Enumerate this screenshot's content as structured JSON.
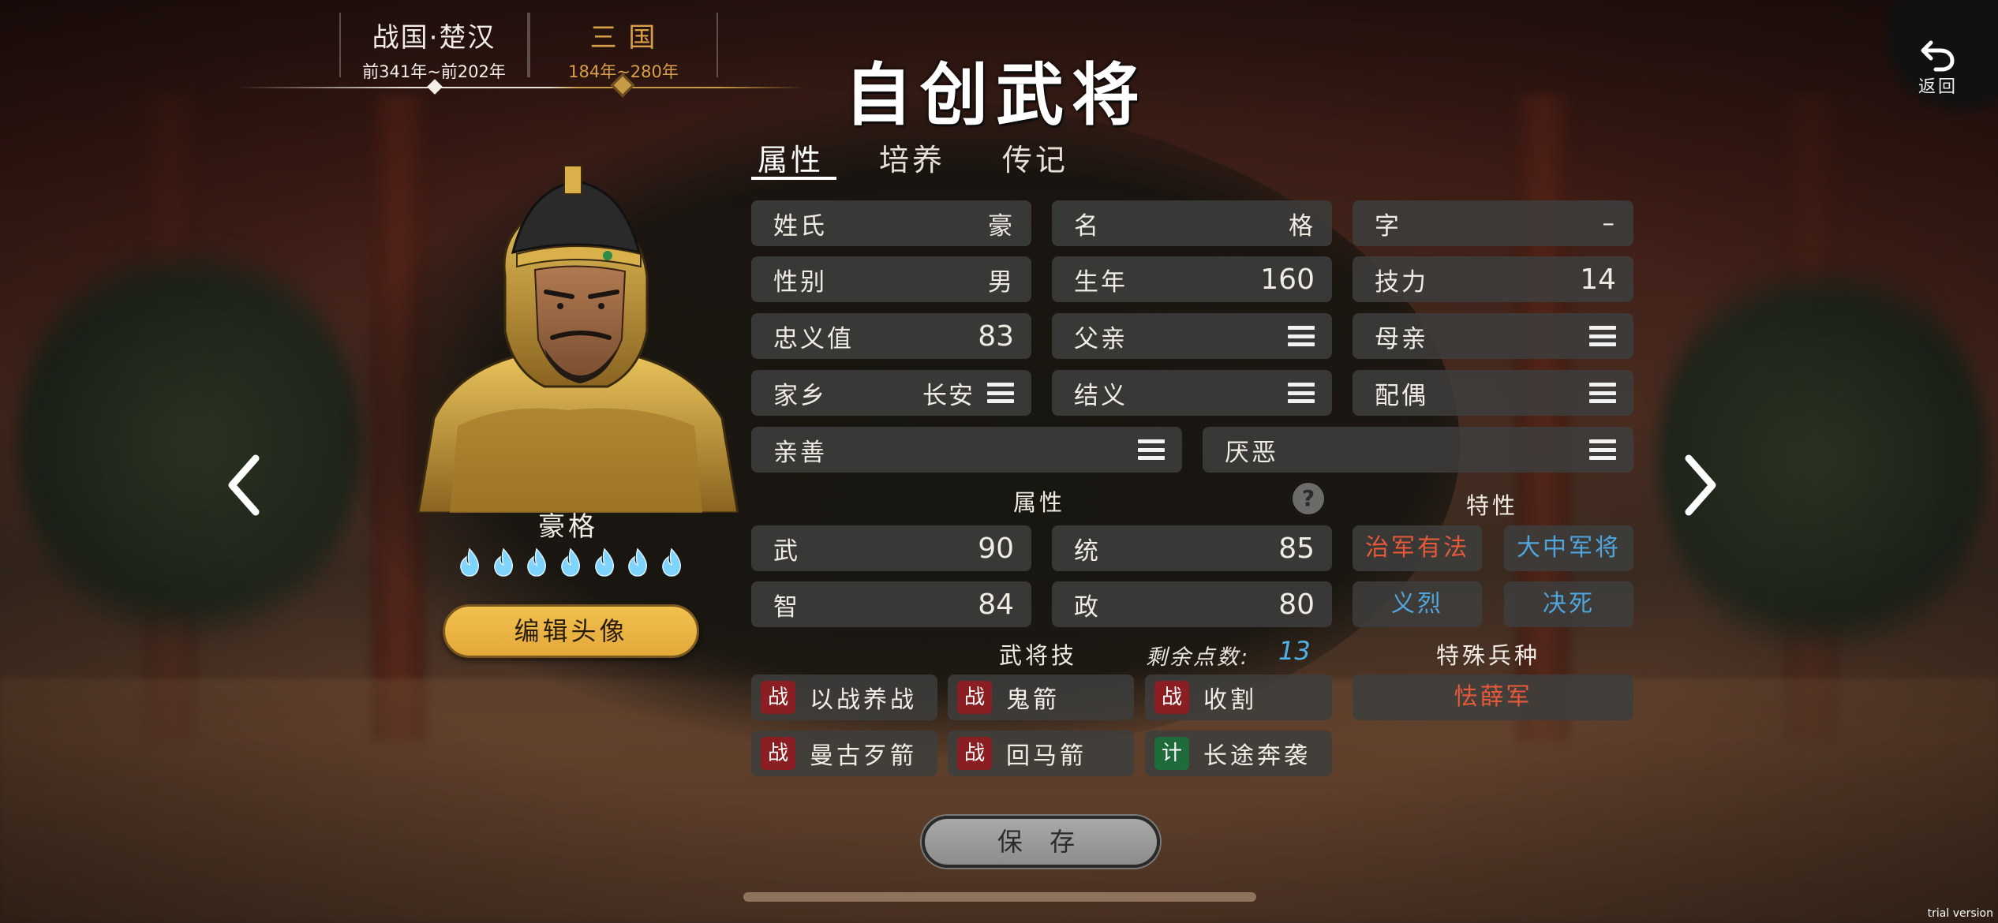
{
  "colors": {
    "accent_gold": "#c79a45",
    "trait_red": "#e8593a",
    "trait_blue": "#4fa6dd",
    "skill_battle": "#8b1e22",
    "skill_strategy": "#1f6b3c",
    "remaining_points": "#4fb1e8"
  },
  "eras": [
    {
      "name": "战国·楚汉",
      "range": "前341年~前202年",
      "active": false
    },
    {
      "name": "三 国",
      "range": "184年~280年",
      "active": true
    }
  ],
  "title": "自创武将",
  "back": {
    "label": "返回",
    "icon": "undo-arrow-icon"
  },
  "tabs": [
    {
      "label": "属性",
      "active": true
    },
    {
      "label": "培养",
      "active": false
    },
    {
      "label": "传记",
      "active": false
    }
  ],
  "hero": {
    "name": "豪格",
    "stars": 7,
    "star_icon": "blue-flame-icon",
    "edit_avatar_label": "编辑头像",
    "portrait_icon": "general-portrait-icon"
  },
  "info": {
    "surname": {
      "label": "姓氏",
      "value": "豪"
    },
    "given_name": {
      "label": "名",
      "value": "格"
    },
    "courtesy": {
      "label": "字",
      "value": "–"
    },
    "gender": {
      "label": "性别",
      "value": "男"
    },
    "birth_year": {
      "label": "生年",
      "value": "160"
    },
    "skill_points": {
      "label": "技力",
      "value": "14"
    },
    "loyalty": {
      "label": "忠义值",
      "value": "83"
    },
    "father": {
      "label": "父亲"
    },
    "mother": {
      "label": "母亲"
    },
    "hometown": {
      "label": "家乡",
      "value": "长安"
    },
    "sworn": {
      "label": "结义"
    },
    "spouse": {
      "label": "配偶"
    },
    "likes": {
      "label": "亲善"
    },
    "dislikes": {
      "label": "厌恶"
    }
  },
  "attributes": {
    "title": "属性",
    "help": "?",
    "war": {
      "label": "武",
      "value": "90"
    },
    "lead": {
      "label": "统",
      "value": "85"
    },
    "intel": {
      "label": "智",
      "value": "84"
    },
    "politics": {
      "label": "政",
      "value": "80"
    }
  },
  "traits": {
    "title": "特性",
    "items": [
      {
        "label": "治军有法",
        "color": "red"
      },
      {
        "label": "大中军将",
        "color": "blue"
      },
      {
        "label": "义烈",
        "color": "blue"
      },
      {
        "label": "决死",
        "color": "blue"
      }
    ]
  },
  "skills": {
    "title": "武将技",
    "remaining_label": "剩余点数:",
    "remaining_value": "13",
    "items": [
      {
        "type": "战",
        "name": "以战养战"
      },
      {
        "type": "战",
        "name": "鬼箭"
      },
      {
        "type": "战",
        "name": "收割"
      },
      {
        "type": "战",
        "name": "曼古歹箭"
      },
      {
        "type": "战",
        "name": "回马箭"
      },
      {
        "type": "计",
        "name": "长途奔袭"
      }
    ]
  },
  "special_troop": {
    "title": "特殊兵种",
    "value": "怯薛军"
  },
  "save_label": "保 存",
  "watermark": "trial version"
}
